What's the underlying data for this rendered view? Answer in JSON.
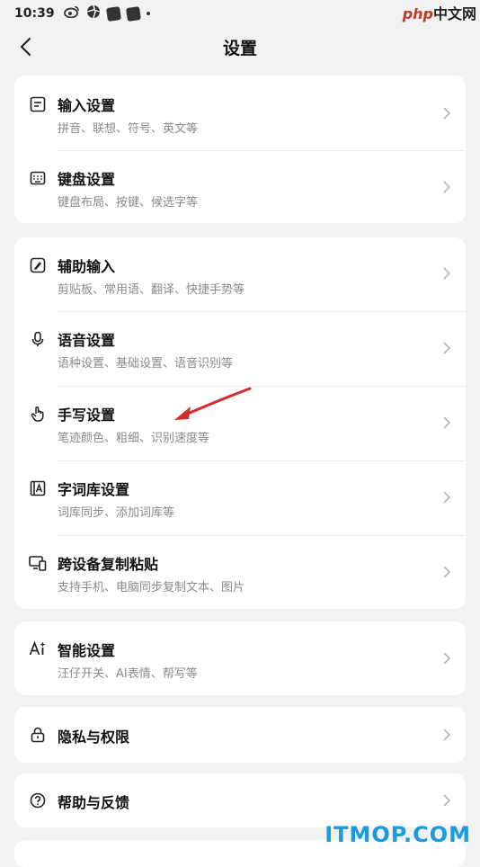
{
  "status": {
    "time": "10:39"
  },
  "watermark": {
    "top_brand": "php",
    "top_suffix": "中文网",
    "bottom": "ITMOP.COM"
  },
  "nav": {
    "title": "设置"
  },
  "groups": [
    {
      "items": [
        {
          "title": "输入设置",
          "sub": "拼音、联想、符号、英文等"
        },
        {
          "title": "键盘设置",
          "sub": "键盘布局、按键、候选字等"
        }
      ]
    },
    {
      "items": [
        {
          "title": "辅助输入",
          "sub": "剪贴板、常用语、翻译、快捷手势等"
        },
        {
          "title": "语音设置",
          "sub": "语种设置、基础设置、语音识别等"
        },
        {
          "title": "手写设置",
          "sub": "笔迹颜色、粗细、识别速度等"
        },
        {
          "title": "字词库设置",
          "sub": "词库同步、添加词库等"
        },
        {
          "title": "跨设备复制粘贴",
          "sub": "支持手机、电脑同步复制文本、图片"
        }
      ]
    },
    {
      "items": [
        {
          "title": "智能设置",
          "sub": "汪仔开关、AI表情、帮写等"
        }
      ]
    },
    {
      "items": [
        {
          "title": "隐私与权限"
        }
      ]
    },
    {
      "items": [
        {
          "title": "帮助与反馈"
        }
      ]
    }
  ],
  "colors": {
    "accent_arrow": "#d42a2a",
    "chevron": "#b5b5b5",
    "subtitle": "#8a8a8a"
  }
}
